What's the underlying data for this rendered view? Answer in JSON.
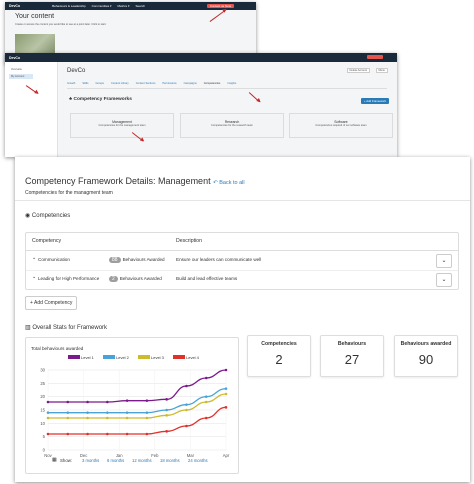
{
  "screen1": {
    "brand": "DevCo",
    "nav": [
      "Behaviours & Leadership",
      "Communities ▾",
      "Metrics ▾",
      "Search"
    ],
    "button": "Contact us Now",
    "page_title": "Your content",
    "subtitle": "Create or access the content you would like to see at a point later. Click to start."
  },
  "screen2": {
    "brand": "DevCo",
    "sidebar": [
      "Overview",
      "My Account"
    ],
    "page_title": "DevCo",
    "header_buttons": [
      "Delete Account",
      "Menu"
    ],
    "tabs": [
      "Growth",
      "Skills",
      "Groups",
      "Content Library",
      "Content Sections",
      "Permissions",
      "Campaigns",
      "Competencies",
      "Insights"
    ],
    "section_title": "Competency Frameworks",
    "add_button": "+ Add Framework",
    "frameworks": [
      {
        "name": "Management",
        "desc": "Competencies for the management team"
      },
      {
        "name": "Research",
        "desc": "Competencies for the research team"
      },
      {
        "name": "Software",
        "desc": "Competencies required of our software team"
      }
    ]
  },
  "main": {
    "title": "Competency Framework Details: Management",
    "back_link": "Back to all",
    "subtitle": "Competencies for the managment team",
    "competencies_heading": "Competencies",
    "table_headers": [
      "Competency",
      "Description"
    ],
    "rows": [
      {
        "name": "Communication",
        "badge": "88",
        "awarded": "Behaviours Awarded",
        "description": "Ensure our leaders can communicate well"
      },
      {
        "name": "Leading for High Performance",
        "badge": "2",
        "awarded": "Behaviours Awarded",
        "description": "Build and lead effective teams"
      }
    ],
    "add_competency": "+ Add Competency",
    "stats_heading": "Overall Stats for Framework",
    "stats": [
      {
        "label": "Competencies",
        "value": "2"
      },
      {
        "label": "Behaviours",
        "value": "27"
      },
      {
        "label": "Behaviours awarded",
        "value": "90"
      }
    ],
    "show_label": "Show:",
    "show_options": [
      "3 months",
      "6 months",
      "12 months",
      "18 months",
      "24 months"
    ]
  },
  "chart_data": {
    "type": "line",
    "title": "Total behaviours awarded",
    "x": [
      "Nov",
      "Dec",
      "Jan",
      "Feb",
      "Mar",
      "Apr"
    ],
    "ylim": [
      0,
      30
    ],
    "yticks": [
      0,
      5,
      10,
      15,
      20,
      25,
      30
    ],
    "grid": true,
    "legend": "top",
    "series": [
      {
        "name": "Level 1",
        "color": "#7b1a8c",
        "values": [
          18,
          18,
          18,
          18,
          18.5,
          18.5,
          19,
          24,
          27,
          30
        ]
      },
      {
        "name": "Level 2",
        "color": "#4aa3d6",
        "values": [
          14,
          14,
          14,
          14,
          14,
          14,
          15,
          17,
          20,
          23
        ]
      },
      {
        "name": "Level 3",
        "color": "#cdbb2e",
        "values": [
          12,
          12,
          12,
          12,
          12,
          12,
          13,
          15,
          18,
          21
        ]
      },
      {
        "name": "Level 4",
        "color": "#e0322b",
        "values": [
          6,
          6,
          6,
          6,
          6,
          6,
          7,
          9,
          12,
          16
        ]
      }
    ]
  }
}
